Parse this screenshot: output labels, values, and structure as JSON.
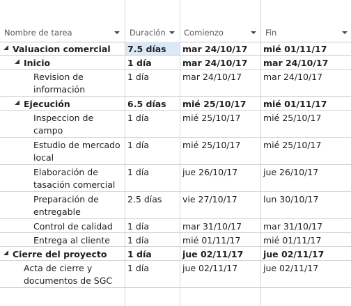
{
  "columns": {
    "name": "Nombre de tarea",
    "duration": "Duración",
    "start": "Comienzo",
    "finish": "Fin"
  },
  "rows": [
    {
      "name": "Valuacion comercial",
      "duration": "7.5 días",
      "start": "mar 24/10/17",
      "finish": "mié 01/11/17",
      "level": 0,
      "summary": true
    },
    {
      "name": "Inicio",
      "duration": "1 día",
      "start": "mar 24/10/17",
      "finish": "mar 24/10/17",
      "level": 1,
      "summary": true
    },
    {
      "name": "Revision de información",
      "duration": "1 día",
      "start": "mar 24/10/17",
      "finish": "mar 24/10/17",
      "level": 2,
      "summary": false
    },
    {
      "name": "Ejecución",
      "duration": "6.5 días",
      "start": "mié 25/10/17",
      "finish": "mié 01/11/17",
      "level": 1,
      "summary": true
    },
    {
      "name": "Inspeccion de campo",
      "duration": "1 día",
      "start": "mié 25/10/17",
      "finish": "mié 25/10/17",
      "level": 2,
      "summary": false
    },
    {
      "name": "Estudio de mercado local",
      "duration": "1 día",
      "start": "mié 25/10/17",
      "finish": "mié 25/10/17",
      "level": 2,
      "summary": false
    },
    {
      "name": "Elaboración de tasación comercial",
      "duration": "1 día",
      "start": "jue 26/10/17",
      "finish": "jue 26/10/17",
      "level": 2,
      "summary": false
    },
    {
      "name": "Preparación de entregable",
      "duration": "2.5 días",
      "start": "vie 27/10/17",
      "finish": "lun 30/10/17",
      "level": 2,
      "summary": false
    },
    {
      "name": "Control de calidad",
      "duration": "1 día",
      "start": "mar 31/10/17",
      "finish": "mar 31/10/17",
      "level": 2,
      "summary": false
    },
    {
      "name": "Entrega al cliente",
      "duration": "1 día",
      "start": "mié 01/11/17",
      "finish": "mié 01/11/17",
      "level": 2,
      "summary": false
    },
    {
      "name": "Cierre del proyecto",
      "duration": "1 día",
      "start": "jue 02/11/17",
      "finish": "jue 02/11/17",
      "level": 0,
      "summary": true
    },
    {
      "name": "Acta de cierre y documentos de SGC",
      "duration": "1 día",
      "start": "jue 02/11/17",
      "finish": "jue 02/11/17",
      "level": 1,
      "summary": false
    }
  ],
  "selected_cell": "rows.0.duration",
  "colors": {
    "selection": "#dde8f6",
    "grid_line": "#d4d4d4",
    "header_text": "#555555"
  }
}
